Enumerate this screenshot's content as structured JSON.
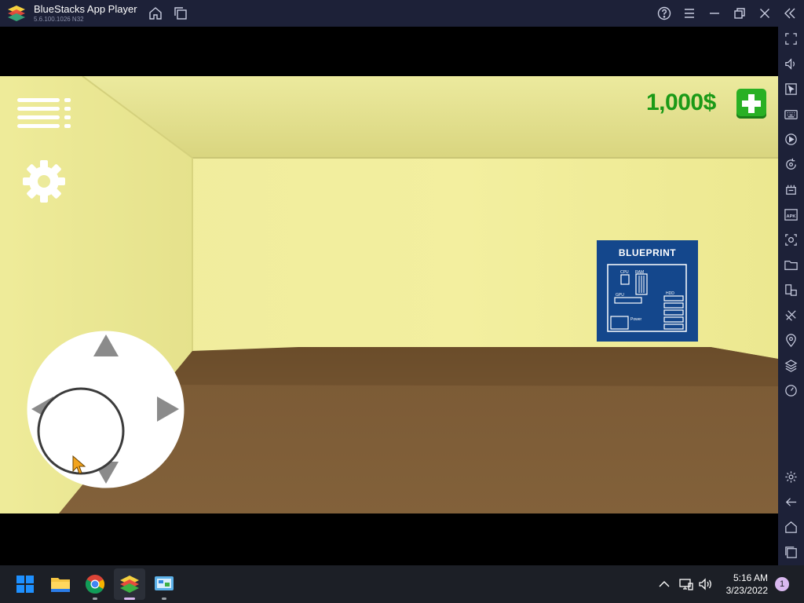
{
  "window": {
    "title": "BlueStacks App Player",
    "version": "5.6.100.1026  N32",
    "controls": [
      "help-icon",
      "menu-icon",
      "minimize-icon",
      "restore-icon",
      "close-icon",
      "collapse-sidebar-icon"
    ],
    "header_nav": [
      "home-icon",
      "multi-instance-icon"
    ]
  },
  "sidebar": {
    "items": [
      "fullscreen-icon",
      "volume-icon",
      "cursor-icon",
      "keyboard-icon",
      "record-icon",
      "rotate-icon",
      "macro-icon",
      "apk-icon",
      "screenshot-icon",
      "folder-icon",
      "multi-device-icon",
      "eco-icon",
      "location-icon",
      "layers-icon",
      "performance-icon"
    ],
    "bottom_items": [
      "settings-icon",
      "back-icon",
      "home-icon",
      "recent-apps-icon"
    ]
  },
  "game": {
    "money": "1,000$",
    "add_money_icon": "plus-icon",
    "menu_icon": "hamburger-icon",
    "settings_icon": "gear-icon",
    "blueprint": {
      "title": "BLUEPRINT",
      "labels": [
        "CPU",
        "RAM",
        "GPU",
        "HDD",
        "Power"
      ]
    },
    "joystick_arrows": [
      "arrow-up-icon",
      "arrow-left-icon",
      "arrow-right-icon",
      "arrow-down-icon"
    ]
  },
  "taskbar": {
    "apps": [
      "start-icon",
      "file-explorer-icon",
      "chrome-icon",
      "bluestacks-icon",
      "multi-instance-manager-icon"
    ],
    "tray": [
      "chevron-up-icon",
      "network-icon",
      "speaker-icon"
    ],
    "time": "5:16 AM",
    "date": "3/23/2022",
    "notifications": "1"
  },
  "colors": {
    "titlebar": "#1d2138",
    "money_green": "#1b9a17",
    "add_button": "#29b024",
    "blueprint": "#14478c",
    "wall": "#f0ed9c",
    "floor": "#7a5a36",
    "taskbar": "#1c1f26"
  }
}
